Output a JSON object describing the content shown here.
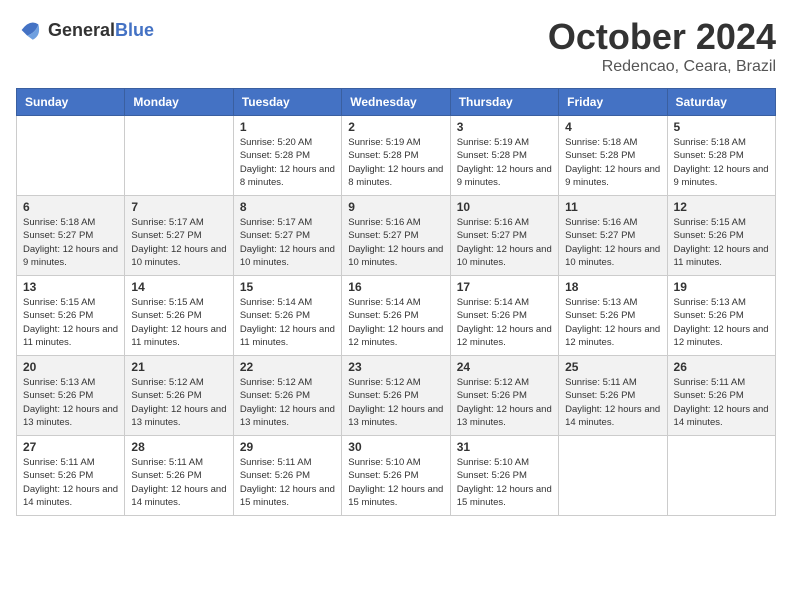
{
  "header": {
    "logo_general": "General",
    "logo_blue": "Blue",
    "title": "October 2024",
    "location": "Redencao, Ceara, Brazil"
  },
  "days_of_week": [
    "Sunday",
    "Monday",
    "Tuesday",
    "Wednesday",
    "Thursday",
    "Friday",
    "Saturday"
  ],
  "weeks": [
    [
      {
        "day": "",
        "sunrise": "",
        "sunset": "",
        "daylight": ""
      },
      {
        "day": "",
        "sunrise": "",
        "sunset": "",
        "daylight": ""
      },
      {
        "day": "1",
        "sunrise": "Sunrise: 5:20 AM",
        "sunset": "Sunset: 5:28 PM",
        "daylight": "Daylight: 12 hours and 8 minutes."
      },
      {
        "day": "2",
        "sunrise": "Sunrise: 5:19 AM",
        "sunset": "Sunset: 5:28 PM",
        "daylight": "Daylight: 12 hours and 8 minutes."
      },
      {
        "day": "3",
        "sunrise": "Sunrise: 5:19 AM",
        "sunset": "Sunset: 5:28 PM",
        "daylight": "Daylight: 12 hours and 9 minutes."
      },
      {
        "day": "4",
        "sunrise": "Sunrise: 5:18 AM",
        "sunset": "Sunset: 5:28 PM",
        "daylight": "Daylight: 12 hours and 9 minutes."
      },
      {
        "day": "5",
        "sunrise": "Sunrise: 5:18 AM",
        "sunset": "Sunset: 5:28 PM",
        "daylight": "Daylight: 12 hours and 9 minutes."
      }
    ],
    [
      {
        "day": "6",
        "sunrise": "Sunrise: 5:18 AM",
        "sunset": "Sunset: 5:27 PM",
        "daylight": "Daylight: 12 hours and 9 minutes."
      },
      {
        "day": "7",
        "sunrise": "Sunrise: 5:17 AM",
        "sunset": "Sunset: 5:27 PM",
        "daylight": "Daylight: 12 hours and 10 minutes."
      },
      {
        "day": "8",
        "sunrise": "Sunrise: 5:17 AM",
        "sunset": "Sunset: 5:27 PM",
        "daylight": "Daylight: 12 hours and 10 minutes."
      },
      {
        "day": "9",
        "sunrise": "Sunrise: 5:16 AM",
        "sunset": "Sunset: 5:27 PM",
        "daylight": "Daylight: 12 hours and 10 minutes."
      },
      {
        "day": "10",
        "sunrise": "Sunrise: 5:16 AM",
        "sunset": "Sunset: 5:27 PM",
        "daylight": "Daylight: 12 hours and 10 minutes."
      },
      {
        "day": "11",
        "sunrise": "Sunrise: 5:16 AM",
        "sunset": "Sunset: 5:27 PM",
        "daylight": "Daylight: 12 hours and 10 minutes."
      },
      {
        "day": "12",
        "sunrise": "Sunrise: 5:15 AM",
        "sunset": "Sunset: 5:26 PM",
        "daylight": "Daylight: 12 hours and 11 minutes."
      }
    ],
    [
      {
        "day": "13",
        "sunrise": "Sunrise: 5:15 AM",
        "sunset": "Sunset: 5:26 PM",
        "daylight": "Daylight: 12 hours and 11 minutes."
      },
      {
        "day": "14",
        "sunrise": "Sunrise: 5:15 AM",
        "sunset": "Sunset: 5:26 PM",
        "daylight": "Daylight: 12 hours and 11 minutes."
      },
      {
        "day": "15",
        "sunrise": "Sunrise: 5:14 AM",
        "sunset": "Sunset: 5:26 PM",
        "daylight": "Daylight: 12 hours and 11 minutes."
      },
      {
        "day": "16",
        "sunrise": "Sunrise: 5:14 AM",
        "sunset": "Sunset: 5:26 PM",
        "daylight": "Daylight: 12 hours and 12 minutes."
      },
      {
        "day": "17",
        "sunrise": "Sunrise: 5:14 AM",
        "sunset": "Sunset: 5:26 PM",
        "daylight": "Daylight: 12 hours and 12 minutes."
      },
      {
        "day": "18",
        "sunrise": "Sunrise: 5:13 AM",
        "sunset": "Sunset: 5:26 PM",
        "daylight": "Daylight: 12 hours and 12 minutes."
      },
      {
        "day": "19",
        "sunrise": "Sunrise: 5:13 AM",
        "sunset": "Sunset: 5:26 PM",
        "daylight": "Daylight: 12 hours and 12 minutes."
      }
    ],
    [
      {
        "day": "20",
        "sunrise": "Sunrise: 5:13 AM",
        "sunset": "Sunset: 5:26 PM",
        "daylight": "Daylight: 12 hours and 13 minutes."
      },
      {
        "day": "21",
        "sunrise": "Sunrise: 5:12 AM",
        "sunset": "Sunset: 5:26 PM",
        "daylight": "Daylight: 12 hours and 13 minutes."
      },
      {
        "day": "22",
        "sunrise": "Sunrise: 5:12 AM",
        "sunset": "Sunset: 5:26 PM",
        "daylight": "Daylight: 12 hours and 13 minutes."
      },
      {
        "day": "23",
        "sunrise": "Sunrise: 5:12 AM",
        "sunset": "Sunset: 5:26 PM",
        "daylight": "Daylight: 12 hours and 13 minutes."
      },
      {
        "day": "24",
        "sunrise": "Sunrise: 5:12 AM",
        "sunset": "Sunset: 5:26 PM",
        "daylight": "Daylight: 12 hours and 13 minutes."
      },
      {
        "day": "25",
        "sunrise": "Sunrise: 5:11 AM",
        "sunset": "Sunset: 5:26 PM",
        "daylight": "Daylight: 12 hours and 14 minutes."
      },
      {
        "day": "26",
        "sunrise": "Sunrise: 5:11 AM",
        "sunset": "Sunset: 5:26 PM",
        "daylight": "Daylight: 12 hours and 14 minutes."
      }
    ],
    [
      {
        "day": "27",
        "sunrise": "Sunrise: 5:11 AM",
        "sunset": "Sunset: 5:26 PM",
        "daylight": "Daylight: 12 hours and 14 minutes."
      },
      {
        "day": "28",
        "sunrise": "Sunrise: 5:11 AM",
        "sunset": "Sunset: 5:26 PM",
        "daylight": "Daylight: 12 hours and 14 minutes."
      },
      {
        "day": "29",
        "sunrise": "Sunrise: 5:11 AM",
        "sunset": "Sunset: 5:26 PM",
        "daylight": "Daylight: 12 hours and 15 minutes."
      },
      {
        "day": "30",
        "sunrise": "Sunrise: 5:10 AM",
        "sunset": "Sunset: 5:26 PM",
        "daylight": "Daylight: 12 hours and 15 minutes."
      },
      {
        "day": "31",
        "sunrise": "Sunrise: 5:10 AM",
        "sunset": "Sunset: 5:26 PM",
        "daylight": "Daylight: 12 hours and 15 minutes."
      },
      {
        "day": "",
        "sunrise": "",
        "sunset": "",
        "daylight": ""
      },
      {
        "day": "",
        "sunrise": "",
        "sunset": "",
        "daylight": ""
      }
    ]
  ],
  "colors": {
    "header_bg": "#4472c4",
    "header_text": "#ffffff",
    "row_even": "#f2f2f2",
    "row_odd": "#ffffff",
    "border": "#cccccc",
    "title_text": "#333333",
    "location_text": "#555555"
  }
}
